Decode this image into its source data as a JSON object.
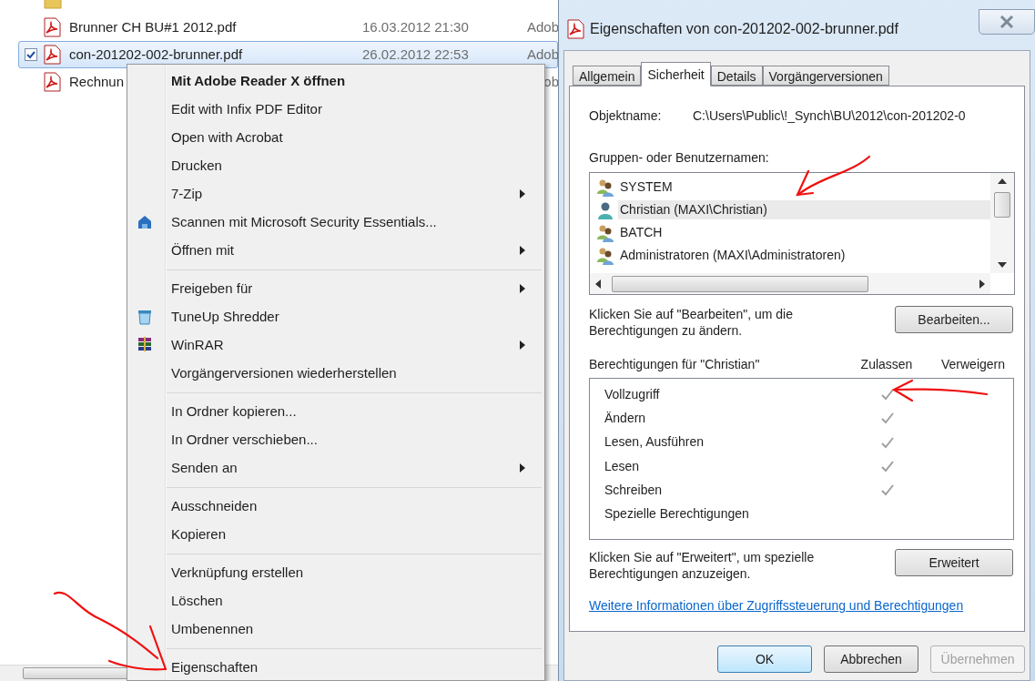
{
  "explorer": {
    "files": [
      {
        "name": "Brunner CH BU#1 2012.pdf",
        "modified": "16.03.2012 21:30",
        "type": "Adob",
        "selected": false
      },
      {
        "name": "con-201202-002-brunner.pdf",
        "modified": "26.02.2012 22:53",
        "type": "Adob",
        "selected": true
      },
      {
        "name": "Rechnun",
        "type": "ob",
        "selected": false
      }
    ]
  },
  "context_menu": {
    "groups": [
      [
        {
          "label": "Mit Adobe Reader X öffnen",
          "default": true,
          "submenu": false
        },
        {
          "label": "Edit with Infix PDF Editor",
          "default": false,
          "submenu": false
        },
        {
          "label": "Open with Acrobat",
          "default": false,
          "submenu": false
        },
        {
          "label": "Drucken",
          "default": false,
          "submenu": false
        },
        {
          "label": "7-Zip",
          "default": false,
          "submenu": true
        },
        {
          "label": "Scannen mit Microsoft Security Essentials...",
          "default": false,
          "submenu": false,
          "kind": "shield"
        },
        {
          "label": "Öffnen mit",
          "default": false,
          "submenu": true
        }
      ],
      [
        {
          "label": "Freigeben für",
          "default": false,
          "submenu": true
        },
        {
          "label": "TuneUp Shredder",
          "default": false,
          "submenu": false,
          "kind": "bin"
        },
        {
          "label": "WinRAR",
          "default": false,
          "submenu": true,
          "kind": "books"
        },
        {
          "label": "Vorgängerversionen wiederherstellen",
          "default": false,
          "submenu": false
        }
      ],
      [
        {
          "label": "In Ordner kopieren...",
          "default": false,
          "submenu": false
        },
        {
          "label": "In Ordner verschieben...",
          "default": false,
          "submenu": false
        },
        {
          "label": "Senden an",
          "default": false,
          "submenu": true
        }
      ],
      [
        {
          "label": "Ausschneiden",
          "default": false,
          "submenu": false
        },
        {
          "label": "Kopieren",
          "default": false,
          "submenu": false
        }
      ],
      [
        {
          "label": "Verknüpfung erstellen",
          "default": false,
          "submenu": false
        },
        {
          "label": "Löschen",
          "default": false,
          "submenu": false
        },
        {
          "label": "Umbenennen",
          "default": false,
          "submenu": false
        }
      ],
      [
        {
          "label": "Eigenschaften",
          "default": false,
          "submenu": false
        }
      ]
    ]
  },
  "dialog": {
    "title": "Eigenschaften von con-201202-002-brunner.pdf",
    "tabs": [
      {
        "label": "Allgemein",
        "selected": false
      },
      {
        "label": "Sicherheit",
        "selected": true
      },
      {
        "label": "Details",
        "selected": false
      },
      {
        "label": "Vorgängerversionen",
        "selected": false
      }
    ],
    "object_label": "Objektname:",
    "object_value": "C:\\Users\\Public\\!_Synch\\BU\\2012\\con-201202-0",
    "principals_label": "Gruppen- oder Benutzernamen:",
    "principals": [
      {
        "name": "SYSTEM",
        "kind": "group",
        "selected": false
      },
      {
        "name": "Christian (MAXI\\Christian)",
        "kind": "user",
        "selected": true
      },
      {
        "name": "BATCH",
        "kind": "group",
        "selected": false
      },
      {
        "name": "Administratoren (MAXI\\Administratoren)",
        "kind": "group",
        "selected": false
      }
    ],
    "edit_hint": "Klicken Sie auf \"Bearbeiten\", um die Berechtigungen zu ändern.",
    "edit_button": "Bearbeiten...",
    "permissions_label": "Berechtigungen für \"Christian\"",
    "columns": [
      "Zulassen",
      "Verweigern"
    ],
    "permissions": [
      {
        "name": "Vollzugriff",
        "allow": true,
        "deny": false
      },
      {
        "name": "Ändern",
        "allow": true,
        "deny": false
      },
      {
        "name": "Lesen, Ausführen",
        "allow": true,
        "deny": false
      },
      {
        "name": "Lesen",
        "allow": true,
        "deny": false
      },
      {
        "name": "Schreiben",
        "allow": true,
        "deny": false
      },
      {
        "name": "Spezielle Berechtigungen",
        "allow": false,
        "deny": false
      }
    ],
    "advanced_hint": "Klicken Sie auf \"Erweitert\", um spezielle Berechtigungen anzuzeigen.",
    "advanced_button": "Erweitert",
    "link": "Weitere Informationen über Zugriffssteuerung und Berechtigungen",
    "buttons": [
      {
        "label": "OK",
        "default": true,
        "disabled": false
      },
      {
        "label": "Abbrechen",
        "default": false,
        "disabled": false
      },
      {
        "label": "Übernehmen",
        "default": false,
        "disabled": true
      }
    ]
  }
}
